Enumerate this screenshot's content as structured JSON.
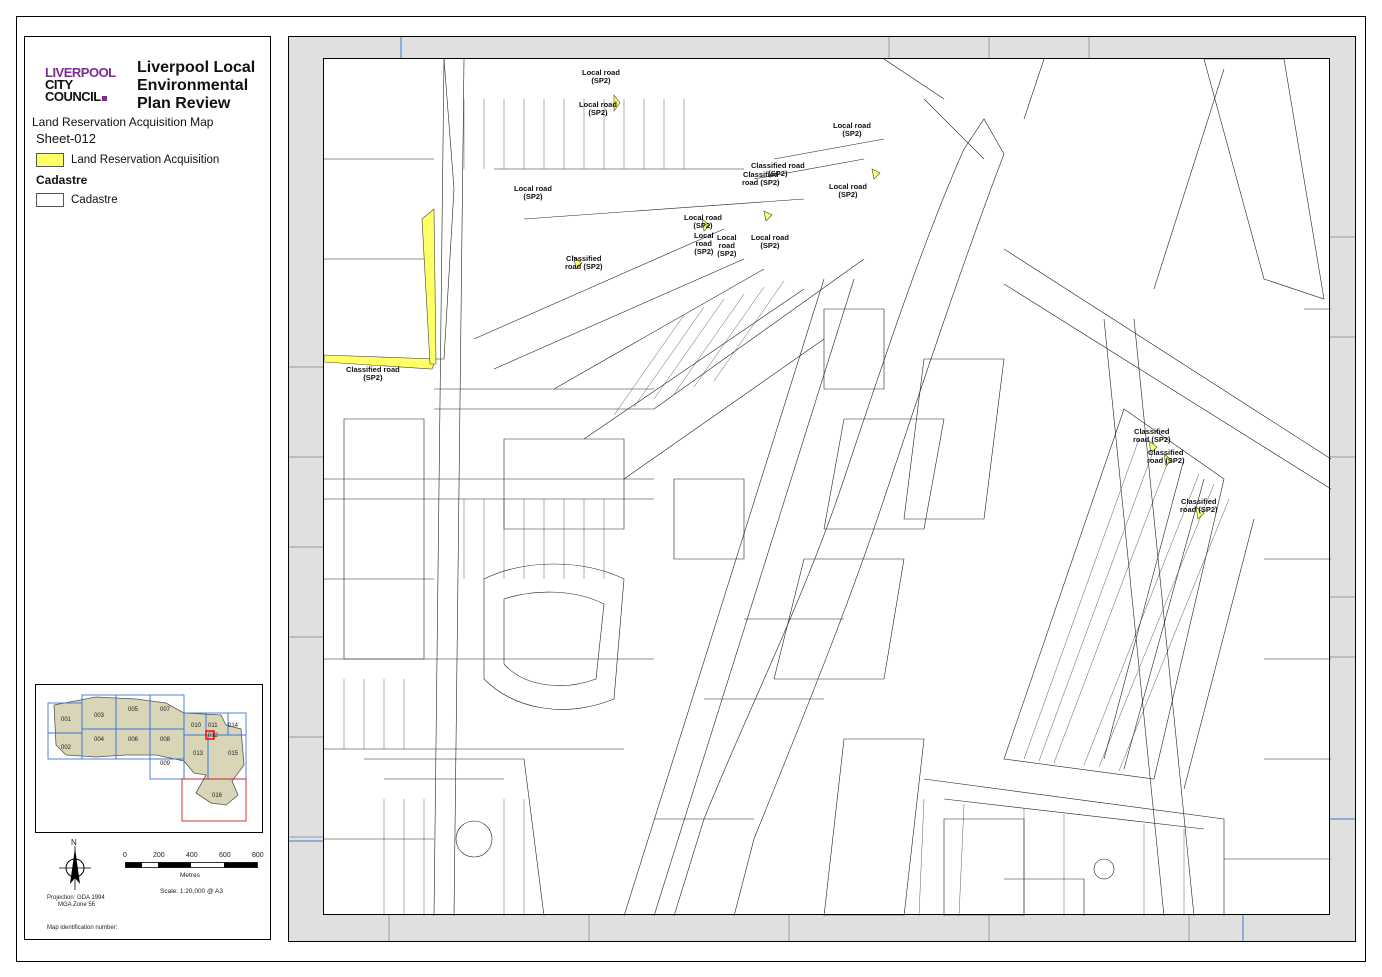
{
  "logo": {
    "line1": "LIVERPOOL",
    "line2": "CITY",
    "line3": "COUNCIL"
  },
  "title": "Liverpool Local Environmental Plan Review",
  "map_title": "Land Reservation Acquisition Map",
  "sheet": "Sheet-012",
  "legend": {
    "item1_label": "Land Reservation Acquisition",
    "item1_color": "#ffff66",
    "heading": "Cadastre",
    "item2_label": "Cadastre",
    "item2_color": "#ffffff"
  },
  "keymap": {
    "tiles": [
      "001",
      "002",
      "003",
      "004",
      "005",
      "006",
      "007",
      "008",
      "009",
      "010",
      "011",
      "012",
      "013",
      "014",
      "015",
      "016"
    ],
    "highlight": "012"
  },
  "north_label": "N",
  "scale": {
    "ticks": [
      "0",
      "200",
      "400",
      "600",
      "800"
    ],
    "unit": "Metres",
    "text": "Scale: 1:20,000 @ A3"
  },
  "projection_line1": "Projection: GDA 1994",
  "projection_line2": "MGA Zone 56",
  "map_id_label": "Map identification number:",
  "road_labels": [
    {
      "l1": "Local road",
      "l2": "(SP2)"
    },
    {
      "l1": "Local road",
      "l2": "(SP2)"
    },
    {
      "l1": "Local road",
      "l2": "(SP2)"
    },
    {
      "l1": "Classified road",
      "l2": "(SP2)"
    },
    {
      "l1": "Classified",
      "l2": "road (SP2)"
    },
    {
      "l1": "Local road",
      "l2": "(SP2)"
    },
    {
      "l1": "Local road",
      "l2": "(SP2)"
    },
    {
      "l1": "Local road",
      "l2": "(SP2)"
    },
    {
      "l1": "Local",
      "l2": "road",
      "l3": "(SP2)"
    },
    {
      "l1": "Local",
      "l2": "road",
      "l3": "(SP2)"
    },
    {
      "l1": "Local road",
      "l2": "(SP2)"
    },
    {
      "l1": "Classified",
      "l2": "road (SP2)"
    },
    {
      "l1": "Classified road",
      "l2": "(SP2)"
    },
    {
      "l1": "Classified",
      "l2": "road (SP2)"
    },
    {
      "l1": "Classified",
      "l2": "road (SP2)"
    },
    {
      "l1": "Classified",
      "l2": "road (SP2)"
    }
  ]
}
